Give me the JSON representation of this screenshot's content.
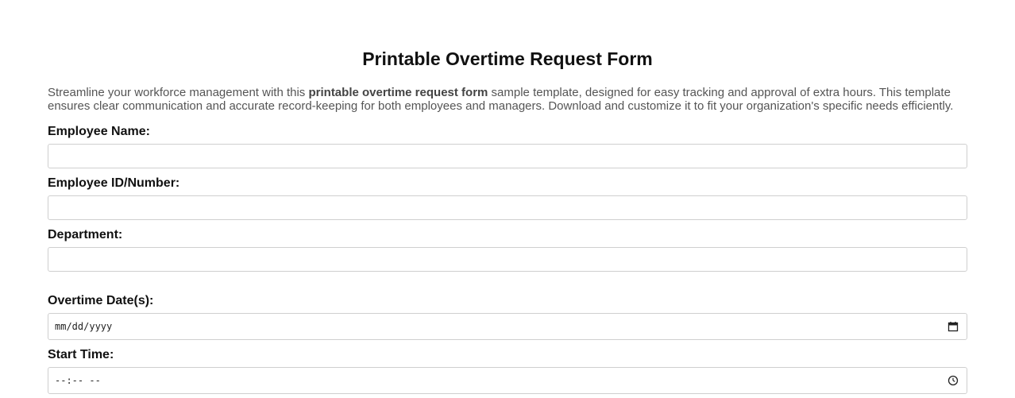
{
  "form": {
    "title": "Printable Overtime Request Form",
    "intro": {
      "line1_before": "Streamline your workforce management with this ",
      "line1_bold": "printable overtime request form",
      "line1_after": " sample template, designed for easy tracking and approval of extra hours. This template",
      "line2": "ensures clear communication and accurate record-keeping for both employees and managers. Download and customize it to fit your organization's specific needs efficiently."
    },
    "fields": {
      "employee_name": {
        "label": "Employee Name:",
        "value": ""
      },
      "employee_id": {
        "label": "Employee ID/Number:",
        "value": ""
      },
      "department": {
        "label": "Department:",
        "value": ""
      },
      "overtime_date": {
        "label": "Overtime Date(s):",
        "placeholder": "mm/dd/yyyy",
        "icon": "calendar-icon"
      },
      "start_time": {
        "label": "Start Time:",
        "placeholder": "--:-- --",
        "icon": "clock-icon"
      }
    }
  }
}
